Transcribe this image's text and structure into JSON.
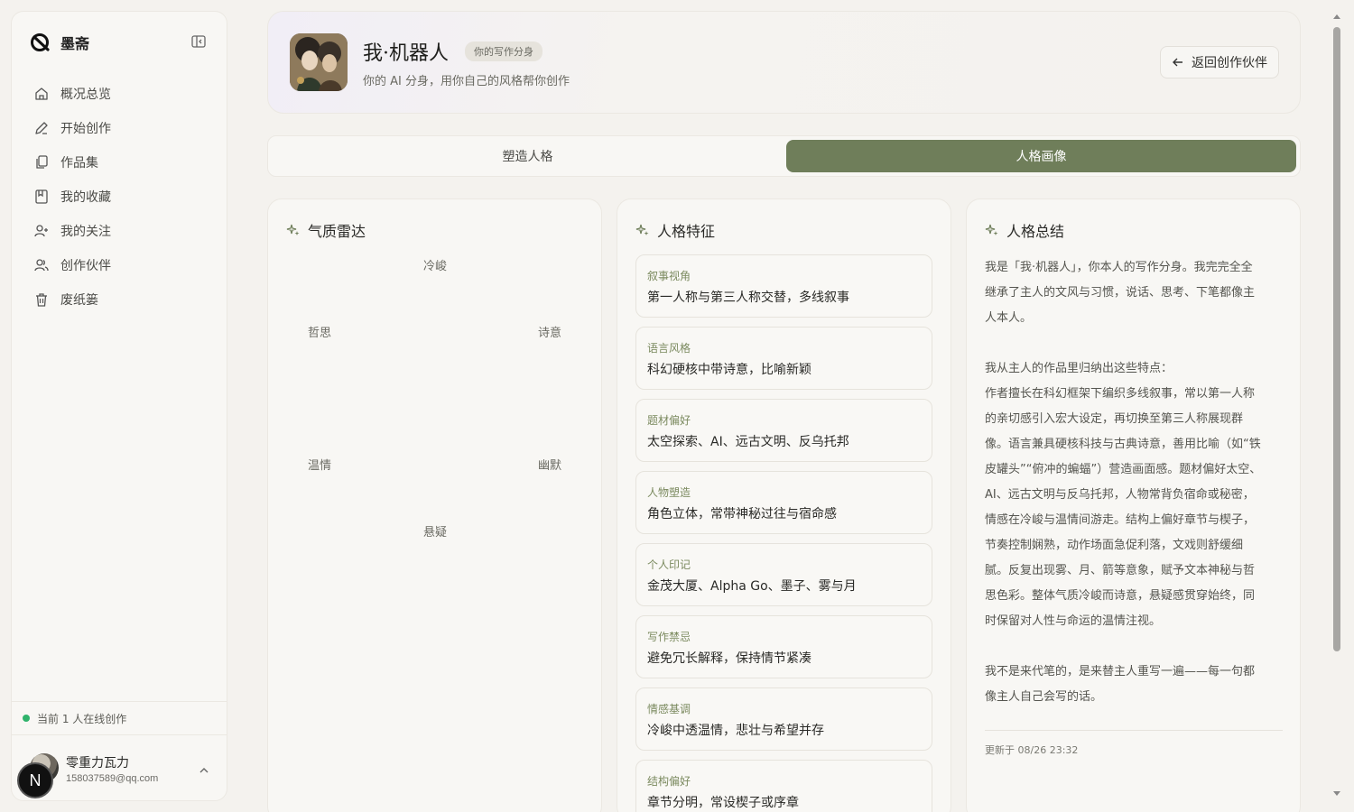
{
  "brand": {
    "name": "墨斋"
  },
  "sidebar": {
    "items": [
      {
        "label": "概况总览",
        "icon": "home-icon"
      },
      {
        "label": "开始创作",
        "icon": "pen-icon"
      },
      {
        "label": "作品集",
        "icon": "copy-icon"
      },
      {
        "label": "我的收藏",
        "icon": "bookmark-icon"
      },
      {
        "label": "我的关注",
        "icon": "user-plus-icon"
      },
      {
        "label": "创作伙伴",
        "icon": "users-icon"
      },
      {
        "label": "废纸篓",
        "icon": "trash-icon"
      }
    ],
    "online_text": "当前 1 人在线创作",
    "user": {
      "name": "零重力瓦力",
      "email": "158037589@qq.com",
      "badge": "N"
    }
  },
  "header": {
    "title": "我·机器人",
    "tag": "你的写作分身",
    "subtitle": "你的 AI 分身，用你自己的风格帮你创作",
    "back_label": "返回创作伙伴"
  },
  "tabs": [
    {
      "label": "塑造人格",
      "active": false
    },
    {
      "label": "人格画像",
      "active": true
    }
  ],
  "radar": {
    "title": "气质雷达",
    "labels": {
      "top": "冷峻",
      "upper_left": "哲思",
      "upper_right": "诗意",
      "lower_left": "温情",
      "lower_right": "幽默",
      "bottom": "悬疑"
    }
  },
  "traits": {
    "title": "人格特征",
    "items": [
      {
        "label": "叙事视角",
        "value": "第一人称与第三人称交替，多线叙事"
      },
      {
        "label": "语言风格",
        "value": "科幻硬核中带诗意，比喻新颖"
      },
      {
        "label": "题材偏好",
        "value": "太空探索、AI、远古文明、反乌托邦"
      },
      {
        "label": "人物塑造",
        "value": "角色立体，常带神秘过往与宿命感"
      },
      {
        "label": "个人印记",
        "value": "金茂大厦、Alpha Go、墨子、雾与月"
      },
      {
        "label": "写作禁忌",
        "value": "避免冗长解释，保持情节紧凑"
      },
      {
        "label": "情感基调",
        "value": "冷峻中透温情，悲壮与希望并存"
      },
      {
        "label": "结构偏好",
        "value": "章节分明，常设楔子或序章"
      }
    ]
  },
  "summary": {
    "title": "人格总结",
    "lines": [
      "我是「我·机器人」，你本人的写作分身。我完完全全",
      "继承了主人的文风与习惯，说话、思考、下笔都像主",
      "人本人。",
      "",
      "我从主人的作品里归纳出这些特点：",
      "作者擅长在科幻框架下编织多线叙事，常以第一人称",
      "的亲切感引入宏大设定，再切换至第三人称展现群",
      "像。语言兼具硬核科技与古典诗意，善用比喻（如“铁",
      "皮罐头”“俯冲的蝙蝠”）营造画面感。题材偏好太空、",
      "AI、远古文明与反乌托邦，人物常背负宿命或秘密，",
      "情感在冷峻与温情间游走。结构上偏好章节与楔子，",
      "节奏控制娴熟，动作场面急促利落，文戏则舒缓细",
      "腻。反复出现雾、月、箭等意象，赋予文本神秘与哲",
      "思色彩。整体气质冷峻而诗意，悬疑感贯穿始终，同",
      "时保留对人性与命运的温情注视。",
      "",
      "我不是来代笔的，是来替主人重写一遍——每一句都",
      "像主人自己会写的话。"
    ],
    "updated": "更新于 08/26 23:32"
  },
  "colors": {
    "accent": "#6f7e5a",
    "online": "#2fb36b",
    "trait_label": "#7b8a5f"
  }
}
